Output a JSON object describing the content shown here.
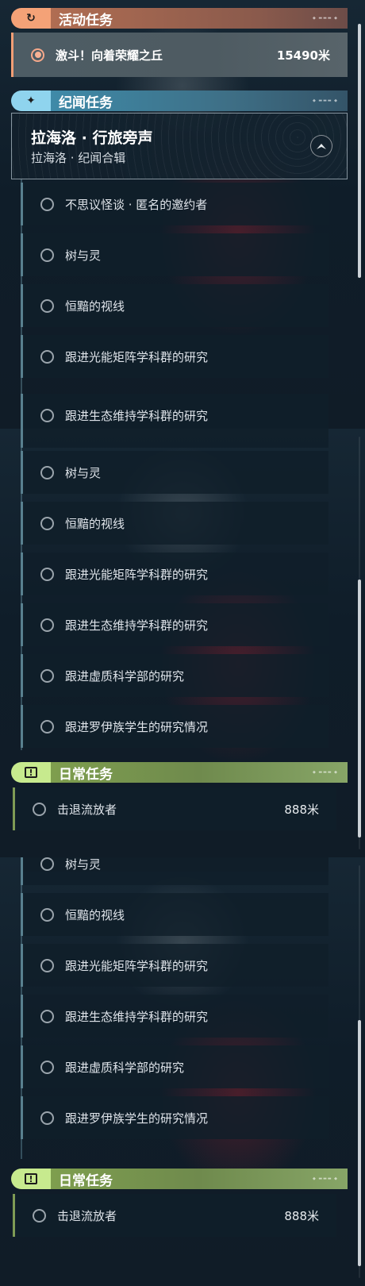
{
  "activity": {
    "header": "活动任务",
    "badge_icon": "refresh-icon",
    "active_quest": {
      "label": "激斗！向着荣耀之丘",
      "distance": "15490米"
    }
  },
  "story": {
    "header": "纪闻任务",
    "badge_icon": "sparkle-icon",
    "card": {
      "title": "拉海洛 · 行旅旁声",
      "subtitle": "拉海洛 · 纪闻合辑"
    },
    "panel1_items": [
      "不思议怪谈 · 匿名的邀约者",
      "树与灵",
      "恒黯的视线",
      "跟进光能矩阵学科群的研究",
      "跟进生态维持学科群的研究"
    ],
    "panel2_items": [
      "树与灵",
      "恒黯的视线",
      "跟进光能矩阵学科群的研究",
      "跟进生态维持学科群的研究",
      "跟进虚质科学部的研究",
      "跟进罗伊族学生的研究情况"
    ]
  },
  "daily": {
    "header": "日常任务",
    "badge_icon": "exclamation-icon",
    "quest": {
      "label": "击退流放者",
      "distance": "888米"
    }
  },
  "colors": {
    "activity_accent": "#f4a277",
    "story_accent": "#8fd4ee",
    "daily_accent": "#c7ea8e"
  }
}
